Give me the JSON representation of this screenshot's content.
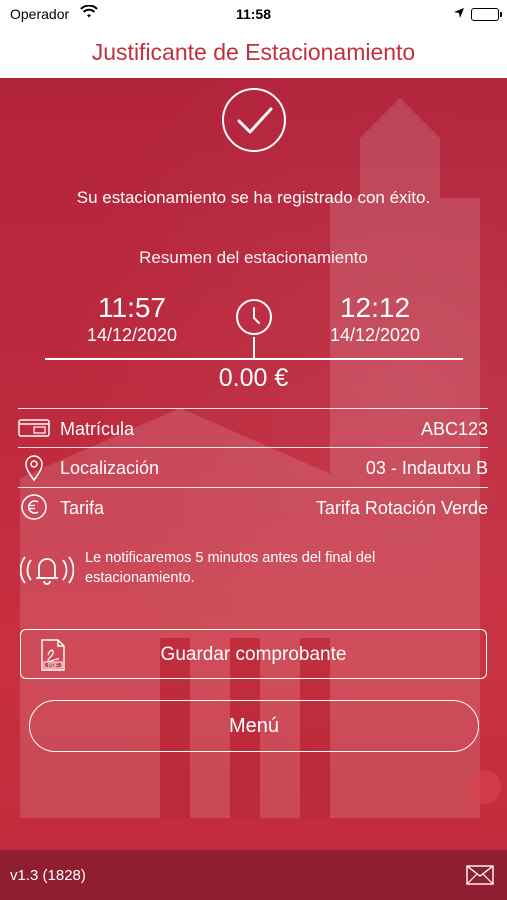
{
  "status_bar": {
    "carrier": "Operador",
    "time": "11:58"
  },
  "header": {
    "title": "Justificante de Estacionamiento"
  },
  "main": {
    "success_message": "Su estacionamiento se ha registrado con éxito.",
    "summary_title": "Resumen del estacionamiento",
    "start": {
      "time": "11:57",
      "date": "14/12/2020"
    },
    "end": {
      "time": "12:12",
      "date": "14/12/2020"
    },
    "price": "0.00 €",
    "rows": [
      {
        "label": "Matrícula",
        "value": "ABC123",
        "icon": "license-plate-icon"
      },
      {
        "label": "Localización",
        "value": "03 - Indautxu B",
        "icon": "location-pin-icon"
      },
      {
        "label": "Tarifa",
        "value": "Tarifa Rotación Verde",
        "icon": "euro-icon"
      }
    ],
    "notification_text": "Le notificaremos 5 minutos antes del final del estacionamiento.",
    "save_button": "Guardar comprobante",
    "menu_button": "Menú"
  },
  "footer": {
    "version": "v1.3 (1828)"
  },
  "colors": {
    "brand_red": "#c0303e",
    "background_red": "#be2a3e",
    "footer_red": "#8e1e30"
  }
}
